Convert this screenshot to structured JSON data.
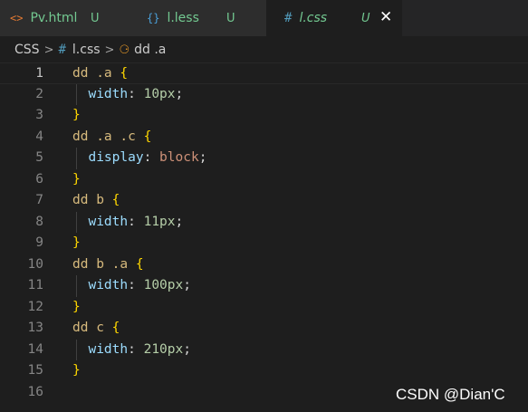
{
  "tabs": [
    {
      "icon": "<>",
      "name": "Pv.html",
      "status": "U"
    },
    {
      "icon": "{}",
      "name": "l.less",
      "status": "U"
    },
    {
      "icon": "#",
      "name": "l.css",
      "status": "U",
      "close": "✕"
    }
  ],
  "breadcrumb": {
    "root": "CSS",
    "sep": ">",
    "file_icon": "#",
    "file": "l.css",
    "symbol_icon": "⚆",
    "symbol": "dd .a"
  },
  "editor": {
    "lines": [
      {
        "n": "1",
        "tokens": [
          {
            "t": "dd .a ",
            "k": "sel"
          },
          {
            "t": "{",
            "k": "brace"
          }
        ]
      },
      {
        "n": "2",
        "tokens": [
          {
            "t": "  "
          },
          {
            "t": "width",
            "k": "prop"
          },
          {
            "t": ": ",
            "k": "punct"
          },
          {
            "t": "10px",
            "k": "num"
          },
          {
            "t": ";",
            "k": "punct"
          }
        ]
      },
      {
        "n": "3",
        "tokens": [
          {
            "t": "}",
            "k": "brace"
          }
        ]
      },
      {
        "n": "4",
        "tokens": [
          {
            "t": "dd .a .c ",
            "k": "sel"
          },
          {
            "t": "{",
            "k": "brace"
          }
        ]
      },
      {
        "n": "5",
        "tokens": [
          {
            "t": "  "
          },
          {
            "t": "display",
            "k": "prop"
          },
          {
            "t": ": ",
            "k": "punct"
          },
          {
            "t": "block",
            "k": "val"
          },
          {
            "t": ";",
            "k": "punct"
          }
        ]
      },
      {
        "n": "6",
        "tokens": [
          {
            "t": "}",
            "k": "brace"
          }
        ]
      },
      {
        "n": "7",
        "tokens": [
          {
            "t": "dd b ",
            "k": "sel"
          },
          {
            "t": "{",
            "k": "brace"
          }
        ]
      },
      {
        "n": "8",
        "tokens": [
          {
            "t": "  "
          },
          {
            "t": "width",
            "k": "prop"
          },
          {
            "t": ": ",
            "k": "punct"
          },
          {
            "t": "11px",
            "k": "num"
          },
          {
            "t": ";",
            "k": "punct"
          }
        ]
      },
      {
        "n": "9",
        "tokens": [
          {
            "t": "}",
            "k": "brace"
          }
        ]
      },
      {
        "n": "10",
        "tokens": [
          {
            "t": "dd b .a ",
            "k": "sel"
          },
          {
            "t": "{",
            "k": "brace"
          }
        ]
      },
      {
        "n": "11",
        "tokens": [
          {
            "t": "  "
          },
          {
            "t": "width",
            "k": "prop"
          },
          {
            "t": ": ",
            "k": "punct"
          },
          {
            "t": "100px",
            "k": "num"
          },
          {
            "t": ";",
            "k": "punct"
          }
        ]
      },
      {
        "n": "12",
        "tokens": [
          {
            "t": "}",
            "k": "brace"
          }
        ]
      },
      {
        "n": "13",
        "tokens": [
          {
            "t": "dd c ",
            "k": "sel"
          },
          {
            "t": "{",
            "k": "brace"
          }
        ]
      },
      {
        "n": "14",
        "tokens": [
          {
            "t": "  "
          },
          {
            "t": "width",
            "k": "prop"
          },
          {
            "t": ": ",
            "k": "punct"
          },
          {
            "t": "210px",
            "k": "num"
          },
          {
            "t": ";",
            "k": "punct"
          }
        ]
      },
      {
        "n": "15",
        "tokens": [
          {
            "t": "}",
            "k": "brace"
          }
        ]
      },
      {
        "n": "16",
        "tokens": []
      }
    ],
    "active_line": "1"
  },
  "watermark": "CSDN @Dian'C",
  "colors": {
    "selector": "#d7ba7d",
    "property": "#9cdcfe",
    "number": "#b5cea8",
    "value": "#ce9178",
    "brace": "#ffd700",
    "untracked": "#73c991"
  }
}
